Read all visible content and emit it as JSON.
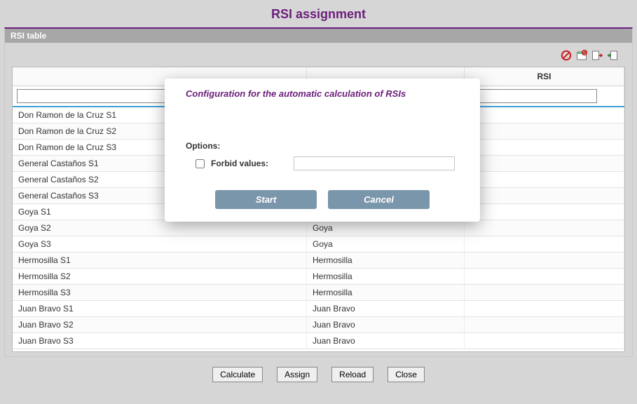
{
  "page": {
    "title": "RSI assignment"
  },
  "panel": {
    "header": "RSI table"
  },
  "toolbar": {
    "icons": [
      "forbid-icon",
      "forbid-calendar-icon",
      "export-icon",
      "import-icon"
    ]
  },
  "table": {
    "columns": [
      "",
      "",
      "RSI"
    ],
    "filters": {
      "col1": "",
      "col2": "",
      "col3": ""
    },
    "rows": [
      {
        "c1": "Don Ramon de la Cruz S1",
        "c2": "",
        "c3": ""
      },
      {
        "c1": "Don Ramon de la Cruz S2",
        "c2": "",
        "c3": ""
      },
      {
        "c1": "Don Ramon de la Cruz S3",
        "c2": "",
        "c3": ""
      },
      {
        "c1": "General Castaños S1",
        "c2": "",
        "c3": ""
      },
      {
        "c1": "General Castaños S2",
        "c2": "",
        "c3": ""
      },
      {
        "c1": "General Castaños S3",
        "c2": "",
        "c3": ""
      },
      {
        "c1": "Goya S1",
        "c2": "",
        "c3": ""
      },
      {
        "c1": "Goya S2",
        "c2": "Goya",
        "c3": ""
      },
      {
        "c1": "Goya S3",
        "c2": "Goya",
        "c3": ""
      },
      {
        "c1": "Hermosilla S1",
        "c2": "Hermosilla",
        "c3": ""
      },
      {
        "c1": "Hermosilla S2",
        "c2": "Hermosilla",
        "c3": ""
      },
      {
        "c1": "Hermosilla S3",
        "c2": "Hermosilla",
        "c3": ""
      },
      {
        "c1": "Juan Bravo S1",
        "c2": "Juan Bravo",
        "c3": ""
      },
      {
        "c1": "Juan Bravo S2",
        "c2": "Juan Bravo",
        "c3": ""
      },
      {
        "c1": "Juan Bravo S3",
        "c2": "Juan Bravo",
        "c3": ""
      }
    ]
  },
  "footer": {
    "calculate": "Calculate",
    "assign": "Assign",
    "reload": "Reload",
    "close": "Close"
  },
  "modal": {
    "title": "Configuration for the automatic calculation of RSIs",
    "options_label": "Options:",
    "forbid_label": "Forbid values:",
    "forbid_checked": false,
    "forbid_value": "",
    "start": "Start",
    "cancel": "Cancel"
  }
}
